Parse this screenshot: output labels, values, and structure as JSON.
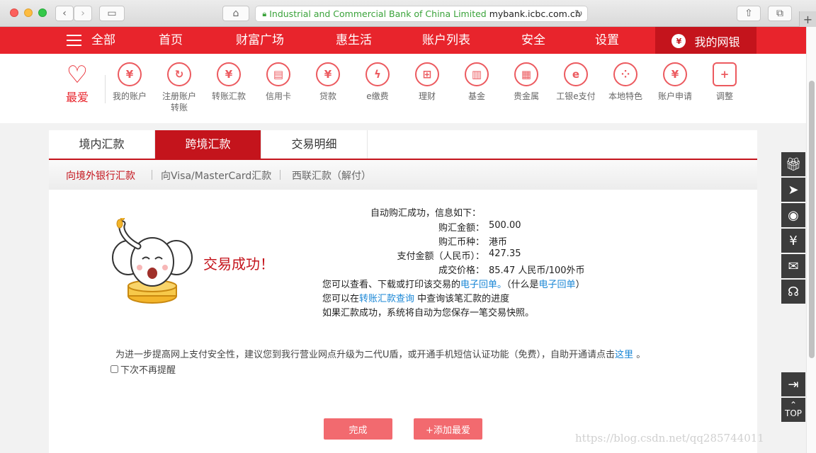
{
  "browser": {
    "org_name": "Industrial and Commercial Bank of China Limited",
    "domain": "mybank.icbc.com.cn",
    "new_tab": "+"
  },
  "topnav": {
    "items": [
      "全部",
      "首页",
      "财富广场",
      "惠生活",
      "账户列表",
      "安全",
      "设置"
    ],
    "mybank": "我的网银",
    "mybank_icon_char": "¥"
  },
  "iconrow": {
    "favorite": "最爱",
    "items": [
      {
        "label": "我的账户",
        "icon": "yen-icon",
        "glyph": "¥"
      },
      {
        "label": "注册账户转账",
        "icon": "transfer-icon",
        "glyph": "↻"
      },
      {
        "label": "转账汇款",
        "icon": "remit-icon",
        "glyph": "¥"
      },
      {
        "label": "信用卡",
        "icon": "credit-card-icon",
        "glyph": "▤"
      },
      {
        "label": "贷款",
        "icon": "loan-bag-icon",
        "glyph": "¥"
      },
      {
        "label": "e缴费",
        "icon": "drop-icon",
        "glyph": "ϟ"
      },
      {
        "label": "理财",
        "icon": "abacus-icon",
        "glyph": "⊞"
      },
      {
        "label": "基金",
        "icon": "fund-chart-icon",
        "glyph": "▥"
      },
      {
        "label": "贵金属",
        "icon": "gold-bars-icon",
        "glyph": "▦"
      },
      {
        "label": "工银e支付",
        "icon": "epay-icon",
        "glyph": "e"
      },
      {
        "label": "本地特色",
        "icon": "local-dots-icon",
        "glyph": "⁘"
      },
      {
        "label": "账户申请",
        "icon": "apply-icon",
        "glyph": "¥"
      },
      {
        "label": "调整",
        "icon": "plus-square-icon",
        "glyph": "+"
      }
    ]
  },
  "tabs": [
    "境内汇款",
    "跨境汇款",
    "交易明细"
  ],
  "subtabs": [
    "向境外银行汇款",
    "向Visa/MasterCard汇款",
    "西联汇款（解付）"
  ],
  "result": {
    "success_text": "交易成功！",
    "heading": "自动购汇成功，信息如下：",
    "rows": [
      {
        "label": "购汇金额：",
        "value": "500.00"
      },
      {
        "label": "购汇币种：",
        "value": "港币"
      },
      {
        "label": "支付金额（人民币）：",
        "value": "427.35"
      },
      {
        "label": "成交价格：",
        "value": "85.47 人民币/100外币"
      }
    ],
    "line1_a": "您可以查看、下载或打印该交易的",
    "line1_link": "电子回单。",
    "line1_b": "（什么是",
    "line1_link2": "电子回单",
    "line1_c": "）",
    "line2_a": "您可以在",
    "line2_link": "转账汇款查询",
    "line2_b": "中查询该笔汇款的进度",
    "line3": "如果汇款成功，系统将自动为您保存一笔交易快照。"
  },
  "notice": {
    "text": "为进一步提高网上支付安全性，建议您到我行营业网点升级为二代U盾，或开通手机短信认证功能（免费），自助开通请点击",
    "link": "这里",
    "end": "。",
    "checkbox_label": "下次不再提醒"
  },
  "buttons": {
    "done": "完成",
    "add_fav": "+添加最爱"
  },
  "side_tools": {
    "top_label": "TOP"
  },
  "watermark": "https://blog.csdn.net/qq285744011"
}
